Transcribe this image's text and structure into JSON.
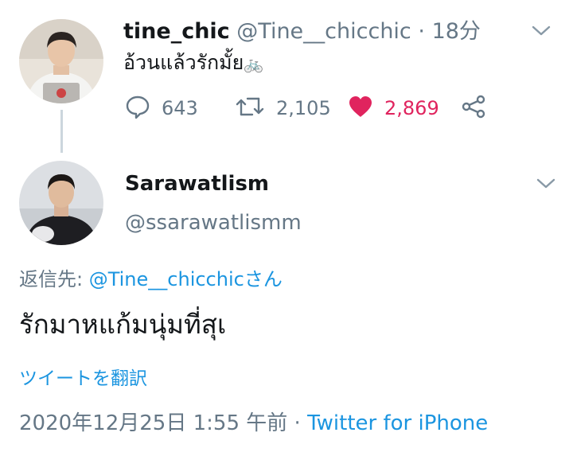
{
  "tweet1": {
    "display_name": "tine_chic",
    "handle": "@Tine__chicchic",
    "separator": "·",
    "time": "18分",
    "text": "อ้วนแล้วรักมั้ย",
    "emoji": "🚲",
    "replies": "643",
    "retweets": "2,105",
    "likes": "2,869"
  },
  "tweet2": {
    "display_name": "Sarawatlism",
    "handle": "@ssarawatlismm",
    "reply_prefix": "返信先: ",
    "reply_target": "@Tine__chicchicさん",
    "text": "รักมาหแก้มนุ่มที่สุเ",
    "translate_label": "ツイートを翻訳",
    "timestamp": "2020年12月25日 1:55 午前",
    "separator": " · ",
    "source": "Twitter for iPhone"
  },
  "colors": {
    "text": "#14171a",
    "secondary": "#657786",
    "link": "#1b95e0",
    "like": "#e0245e",
    "thread_line": "#ccd6dd"
  },
  "icons": [
    "reply-icon",
    "retweet-icon",
    "heart-icon",
    "share-icon",
    "chevron-down-icon"
  ]
}
